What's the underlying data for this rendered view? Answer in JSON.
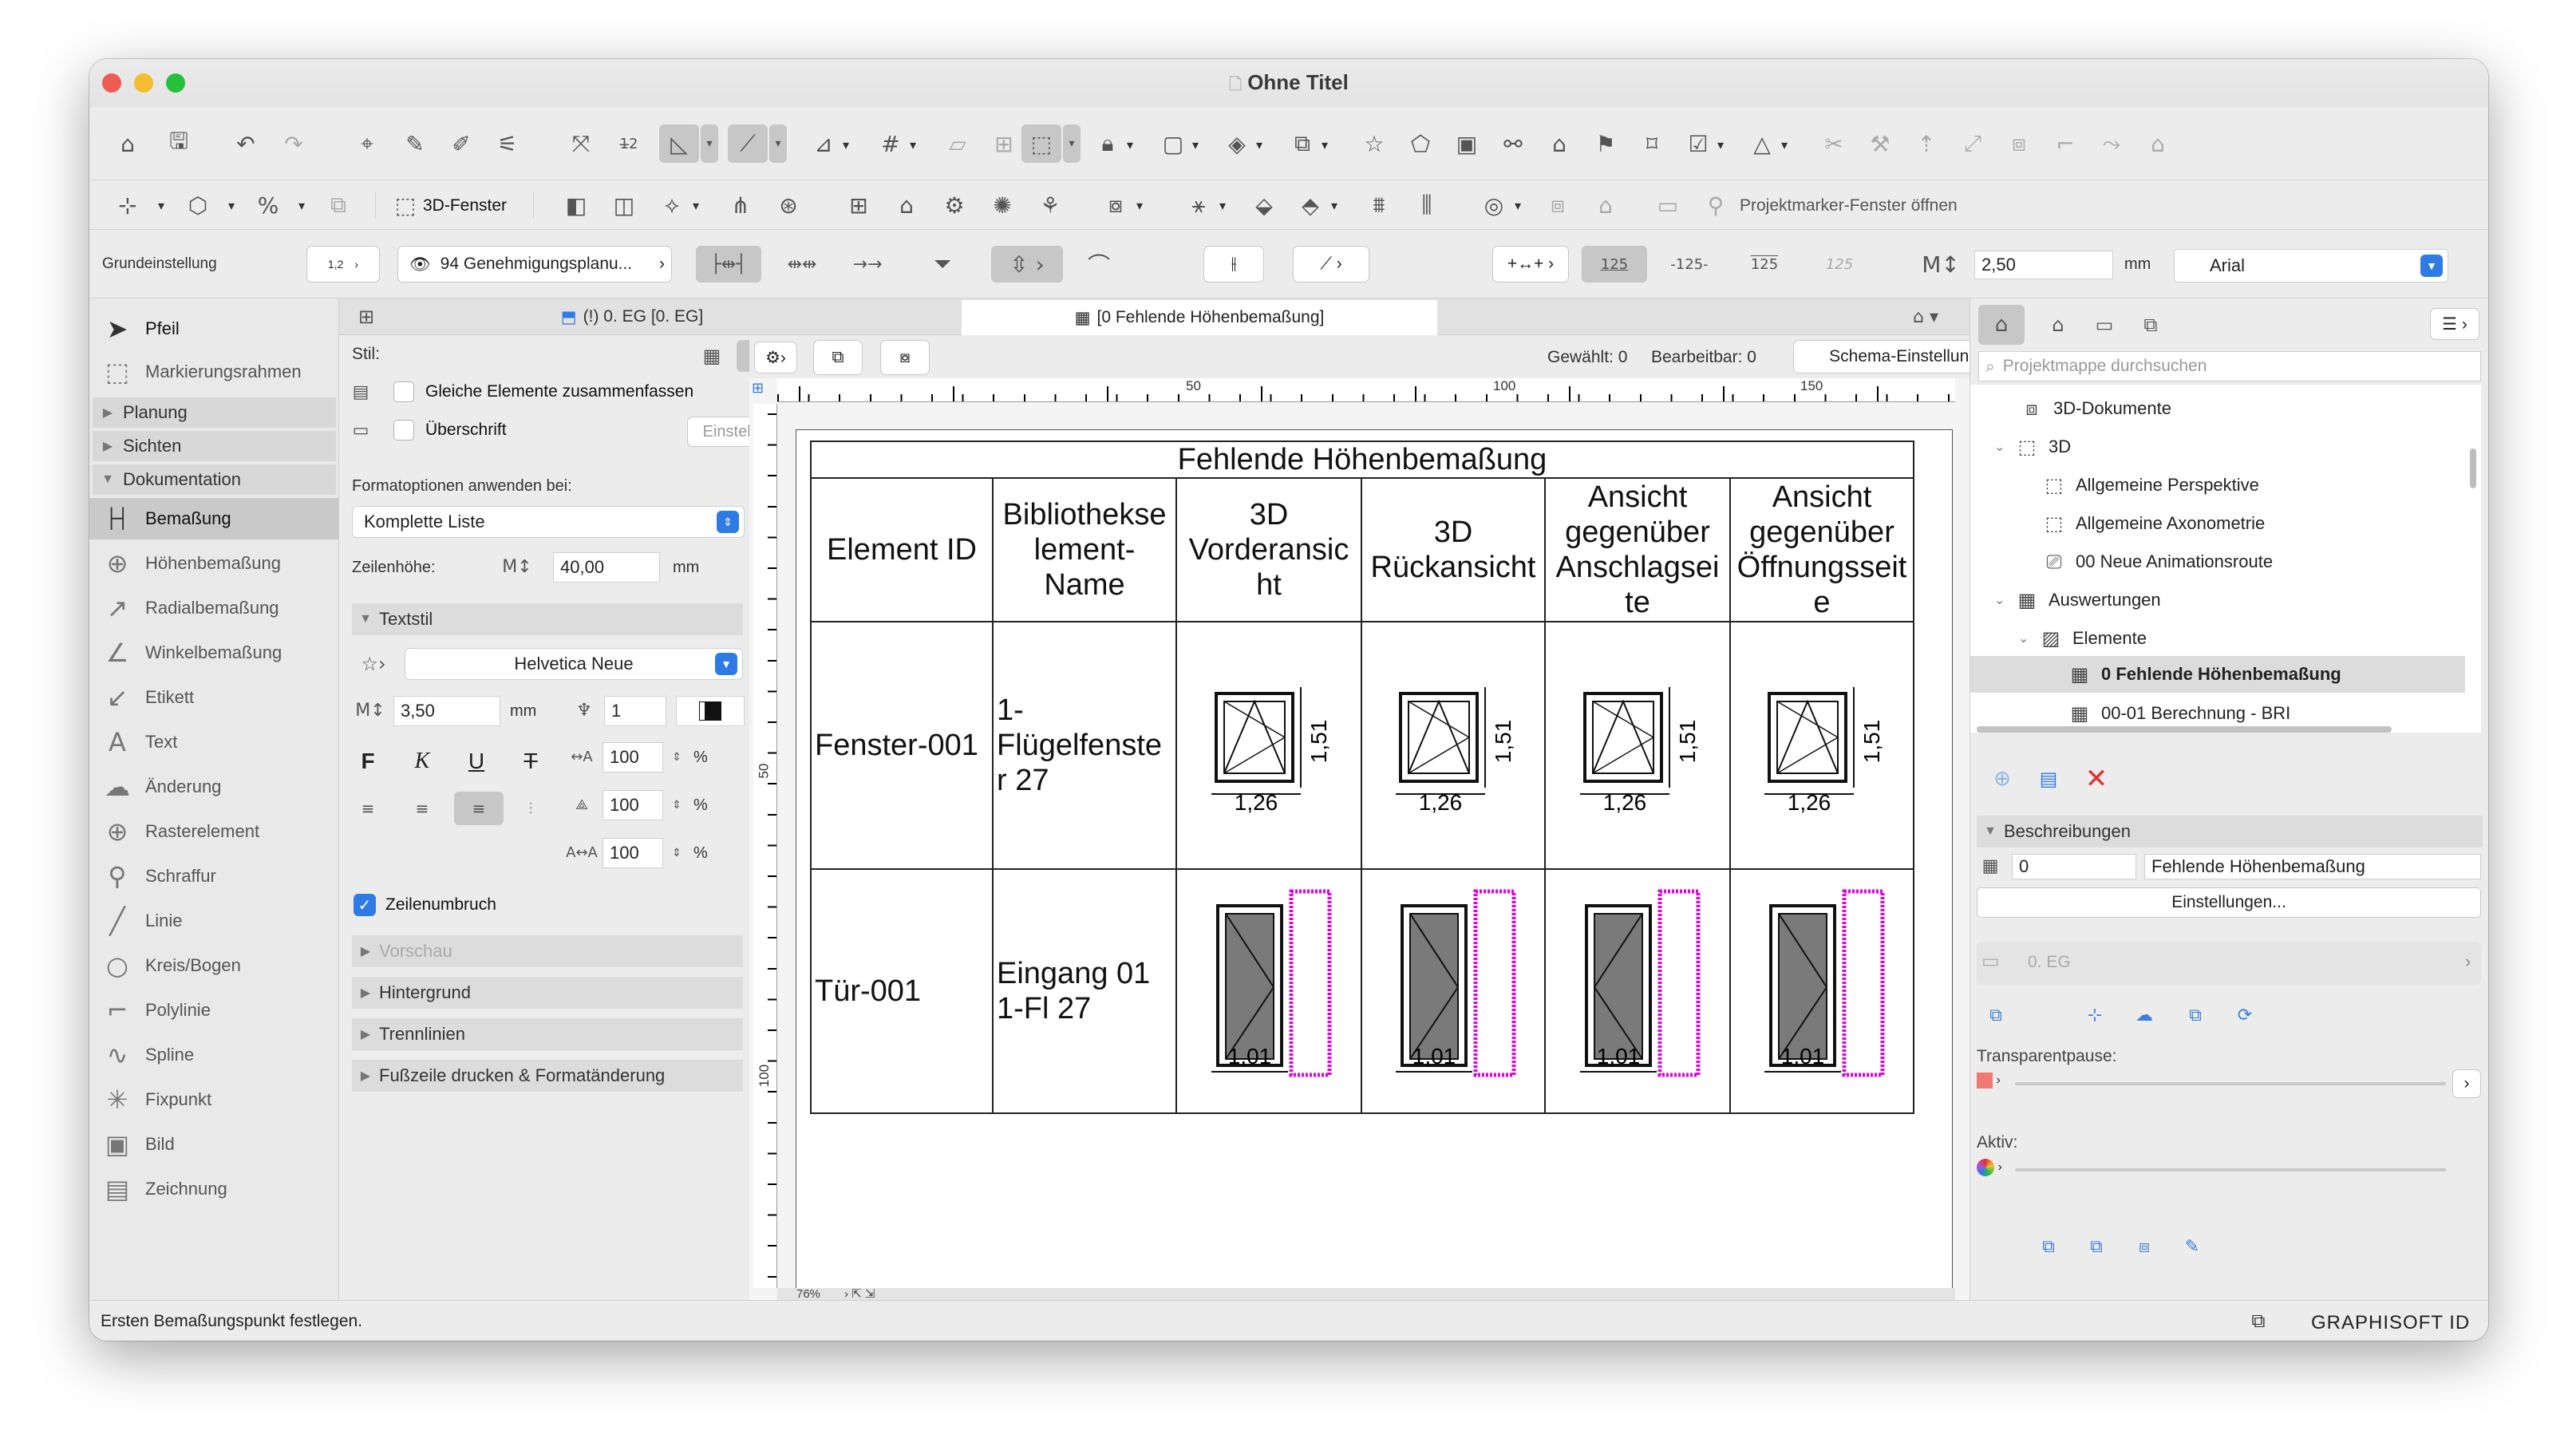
{
  "window": {
    "title": "Ohne Titel"
  },
  "colors": {
    "accent": "#2f7be5",
    "delete": "#e0322f",
    "magenta": "#e100e1",
    "close": "#ee5b53",
    "minimize": "#f3bd2f",
    "zoom": "#26c13b"
  },
  "toolbar2": {
    "window_3d_label": "3D-Fenster",
    "project_marker_label": "Projektmarker-Fenster öffnen"
  },
  "infobox": {
    "preset": "Grundeinstellung",
    "layer": "94 Genehmigungsplanu...",
    "dim_preview": [
      "1,2",
      "-125-",
      "125",
      "125"
    ],
    "text_height": "2,50",
    "unit": "mm",
    "font": "Arial"
  },
  "toolbox": {
    "pointer": "Pfeil",
    "marquee": "Markierungsrahmen",
    "groups": [
      "Planung",
      "Sichten",
      "Dokumentation"
    ],
    "tools": [
      "Bemaßung",
      "Höhenbemaßung",
      "Radialbemaßung",
      "Winkelbemaßung",
      "Etikett",
      "Text",
      "Änderung",
      "Rasterelement",
      "Schraffur",
      "Linie",
      "Kreis/Bogen",
      "Polylinie",
      "Spline",
      "Fixpunkt",
      "Bild",
      "Zeichnung"
    ]
  },
  "tabs": {
    "floor": "(!) 0. EG [0. EG]",
    "schedule": "[0 Fehlende Höhenbemaßung]"
  },
  "settings": {
    "stil": "Stil:",
    "same_elements": "Gleiche Elemente zusammenfassen",
    "heading": "Überschrift",
    "settings_btn": "Einstellungen...",
    "format_options": "Formatoptionen anwenden bei:",
    "format_value": "Komplette Liste",
    "row_height_label": "Zeilenhöhe:",
    "row_height": "40,00",
    "unit_mm": "mm",
    "textstil": "Textstil",
    "font": "Helvetica Neue",
    "font_size": "3,50",
    "pen": "1",
    "scale_pct": [
      "100",
      "100",
      "100"
    ],
    "pct": "%",
    "bold": "F",
    "italic": "K",
    "underline": "U",
    "strike": "T",
    "wrap": "Zeilenumbruch",
    "preview": "Vorschau",
    "background": "Hintergrund",
    "dividers": "Trennlinien",
    "footer": "Fußzeile drucken & Formatänderung"
  },
  "schedule": {
    "selected": "Gewählt: 0",
    "editable": "Bearbeitbar: 0",
    "schema_btn": "Schema-Einstellungen...",
    "ruler_top": [
      "50",
      "100",
      "150"
    ],
    "ruler_left": [
      "50",
      "100"
    ],
    "zoom": "76%",
    "title": "Fehlende Höhenbemaßung",
    "headers": [
      "Element ID",
      "Bibliothekse lement- Name",
      "3D Vorderansic ht",
      "3D Rückansicht",
      "Ansicht gegenüber Anschlagsei te",
      "Ansicht gegenüber Öffnungsseit e"
    ],
    "rows": [
      {
        "id": "Fenster-001",
        "name": "1- Flügelfenste r 27",
        "w": "1,26",
        "h": "1,51"
      },
      {
        "id": "Tür-001",
        "name": "Eingang 01 1-Fl 27",
        "w": "1,01"
      }
    ]
  },
  "navigator": {
    "search_placeholder": "Projektmappe durchsuchen",
    "tree": [
      "3D-Dokumente",
      "3D",
      "Allgemeine Perspektive",
      "Allgemeine Axonometrie",
      "00 Neue Animationsroute",
      "Auswertungen",
      "Elemente",
      "0 Fehlende Höhenbemaßung",
      "00-01 Berechnung - BRI"
    ],
    "descriptions": "Beschreibungen",
    "id": "0",
    "name": "Fehlende Höhenbemaßung",
    "settings_btn": "Einstellungen...",
    "floor": "0. EG",
    "transparent_pause": "Transparentpause:",
    "active": "Aktiv:"
  },
  "status": {
    "message": "Ersten Bemaßungspunkt festlegen.",
    "brand": "GRAPHISOFT ID"
  }
}
